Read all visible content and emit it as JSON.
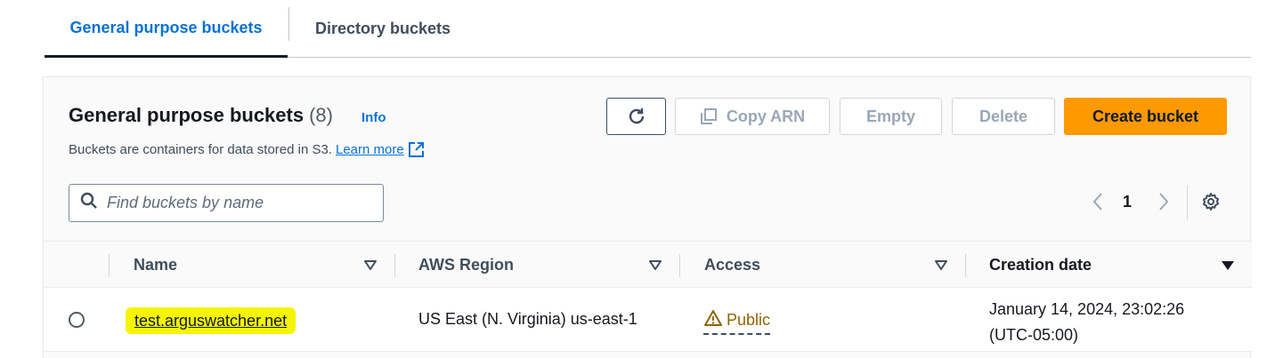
{
  "tabs": {
    "general": "General purpose buckets",
    "directory": "Directory buckets"
  },
  "header": {
    "title": "General purpose buckets",
    "count": "(8)",
    "info": "Info",
    "description": "Buckets are containers for data stored in S3.",
    "learn_more": "Learn more"
  },
  "toolbar": {
    "refresh_icon": "refresh-icon",
    "copy_arn": "Copy ARN",
    "empty": "Empty",
    "delete": "Delete",
    "create": "Create bucket"
  },
  "search": {
    "placeholder": "Find buckets by name"
  },
  "pagination": {
    "page": "1"
  },
  "table": {
    "columns": [
      "Name",
      "AWS Region",
      "Access",
      "Creation date"
    ],
    "rows": [
      {
        "name": "test.arguswatcher.net",
        "region": "US East (N. Virginia) us-east-1",
        "access": "Public",
        "date_line1": "January 14, 2024, 23:02:26",
        "date_line2": "(UTC-05:00)"
      }
    ]
  },
  "colors": {
    "accent": "#0972d3",
    "primary_button": "#ff9900",
    "highlight": "#f5f500",
    "warning": "#8d6605"
  }
}
